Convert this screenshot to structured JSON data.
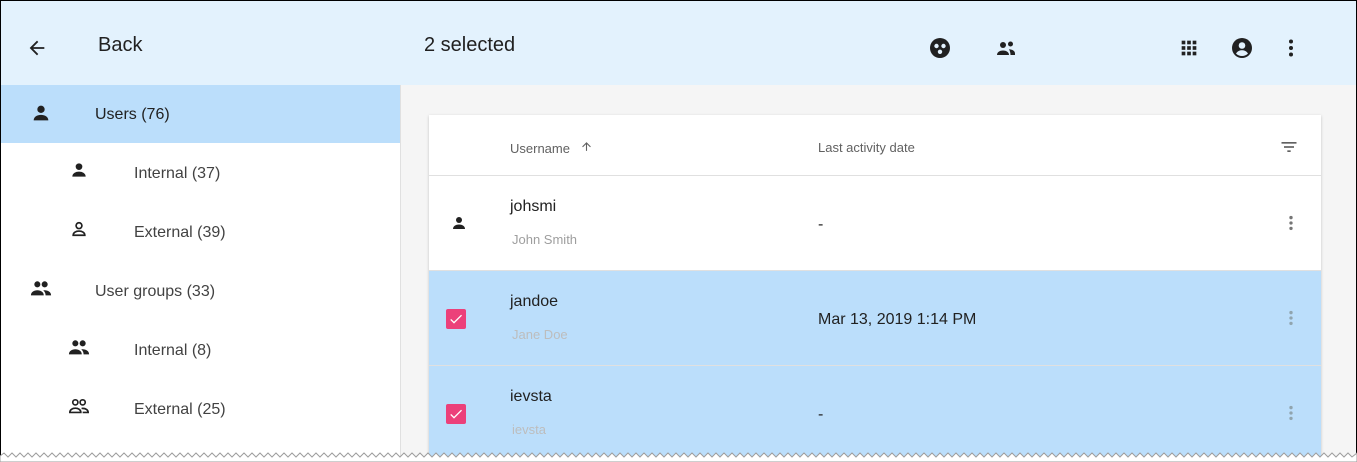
{
  "header": {
    "back_label": "Back",
    "selection_label": "2 selected",
    "icons": [
      "arrow-back-icon",
      "roles-icon",
      "groups-icon",
      "apps-grid-icon",
      "account-circle-icon",
      "more-vert-icon"
    ]
  },
  "sidebar": {
    "items": [
      {
        "label": "Users (76)",
        "icon": "person-icon",
        "active": true
      },
      {
        "label": "Internal (37)",
        "icon": "person-icon",
        "active": false
      },
      {
        "label": "External (39)",
        "icon": "person-outline-icon",
        "active": false
      },
      {
        "label": "User groups (33)",
        "icon": "people-icon",
        "active": false
      },
      {
        "label": "Internal (8)",
        "icon": "people-icon",
        "active": false
      },
      {
        "label": "External (25)",
        "icon": "people-outline-icon",
        "active": false
      }
    ]
  },
  "table": {
    "columns": {
      "username": "Username",
      "last_activity": "Last activity date"
    },
    "sort": {
      "column": "Username",
      "direction": "ascending"
    },
    "rows": [
      {
        "username": "johsmi",
        "full_name": "John Smith",
        "last_activity": "-",
        "selected": false
      },
      {
        "username": "jandoe",
        "full_name": "Jane Doe",
        "last_activity": "Mar 13, 2019 1:14 PM",
        "selected": true
      },
      {
        "username": "ievsta",
        "full_name": "ievsta",
        "last_activity": "-",
        "selected": true
      }
    ]
  },
  "colors": {
    "header_bg": "#e3f2fd",
    "selected_bg": "#bbdefb",
    "checkbox_accent": "#ec407a"
  }
}
